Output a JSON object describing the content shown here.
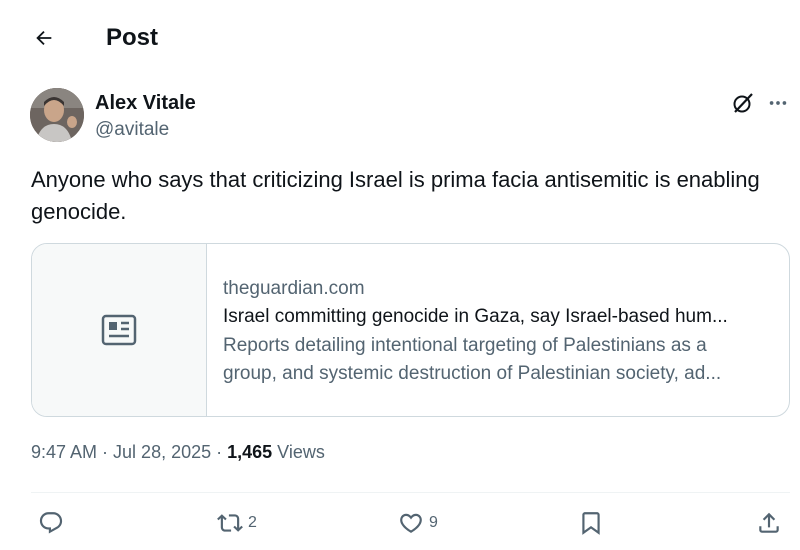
{
  "header": {
    "title": "Post"
  },
  "author": {
    "name": "Alex Vitale",
    "handle": "@avitale"
  },
  "tweet": {
    "text": "Anyone who says that criticizing Israel is prima facia antisemitic is enabling genocide."
  },
  "card": {
    "domain": "theguardian.com",
    "title": "Israel committing genocide in Gaza, say Israel-based hum...",
    "description_line1": "Reports detailing intentional targeting of Palestinians as a",
    "description_line2": "group, and systemic destruction of Palestinian society, ad..."
  },
  "meta": {
    "time": "9:47 AM",
    "separator": " · ",
    "date": "Jul 28, 2025",
    "views_count": "1,465",
    "views_label": " Views"
  },
  "actions": {
    "reply_count": "",
    "repost_count": "2",
    "like_count": "9",
    "bookmark_count": "",
    "share_count": ""
  },
  "icons": {
    "back": "arrow-left-icon",
    "grok": "grok-icon",
    "more": "more-horizontal-icon",
    "card_placeholder": "article-icon",
    "reply": "reply-icon",
    "repost": "repost-icon",
    "like": "heart-icon",
    "bookmark": "bookmark-icon",
    "share": "share-icon"
  },
  "colors": {
    "text_primary": "#0f1419",
    "text_secondary": "#536471",
    "border": "#cfd9de"
  }
}
